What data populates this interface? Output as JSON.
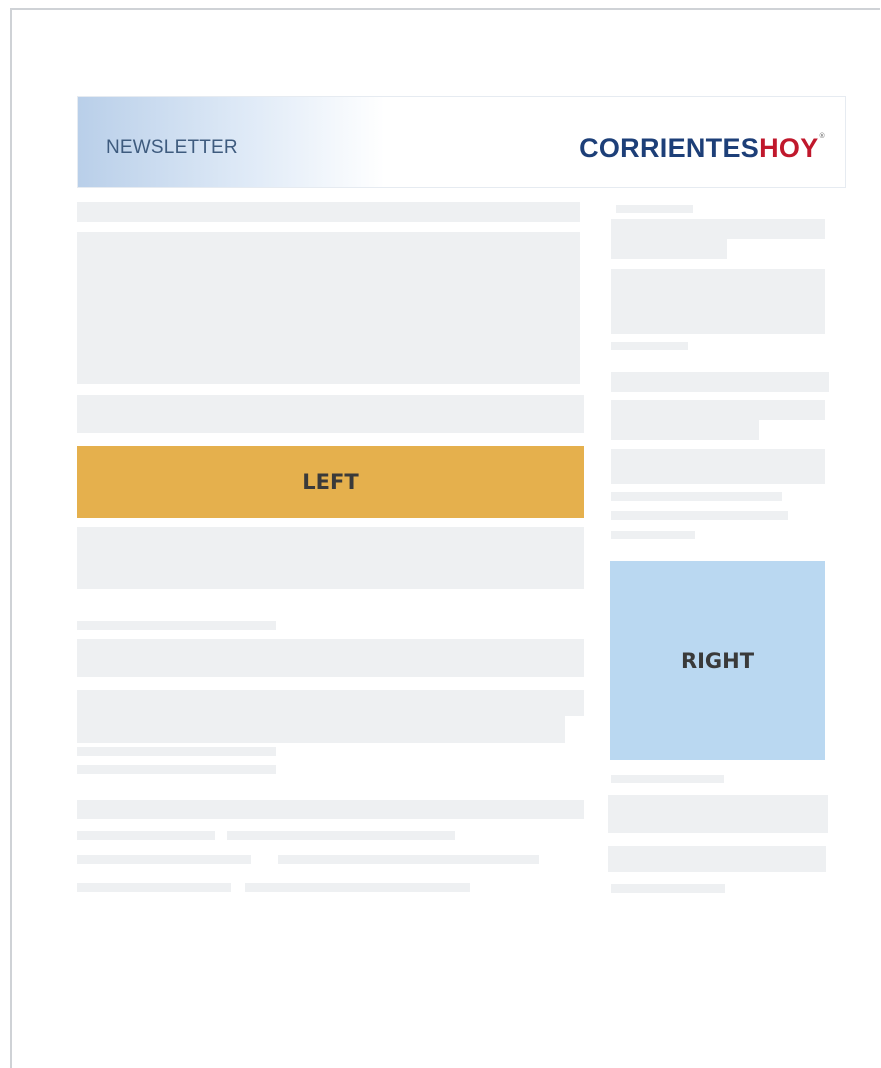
{
  "header": {
    "label": "NEWSLETTER",
    "logo_part1": "CORRIENTES",
    "logo_part2": "HOY",
    "logo_mark": "®"
  },
  "slots": {
    "left_label": "LEFT",
    "right_label": "RIGHT"
  },
  "colors": {
    "left_slot": "#e5b04d",
    "right_slot": "#bad8f1",
    "placeholder": "#eef0f2",
    "logo_blue": "#1d3f78",
    "logo_red": "#c0182c"
  }
}
